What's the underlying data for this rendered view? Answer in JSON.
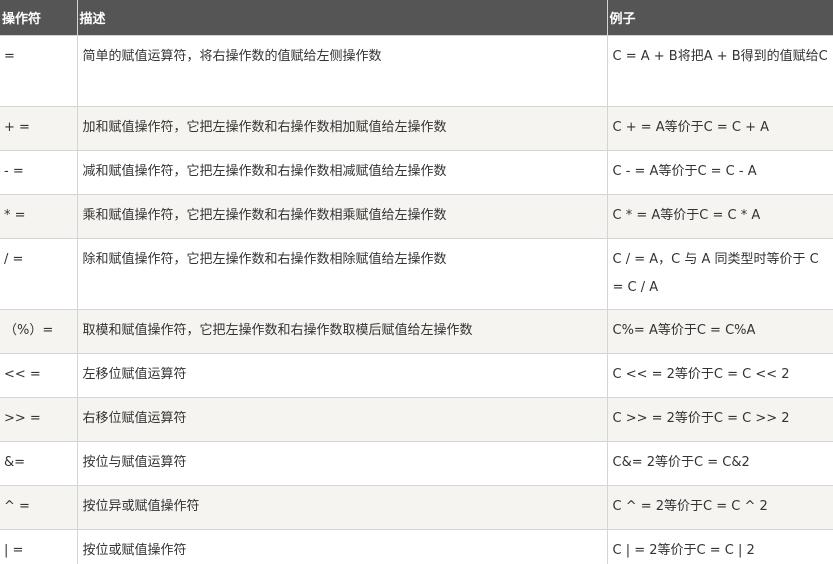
{
  "table": {
    "headers": [
      "操作符",
      "描述",
      "例子"
    ],
    "rows": [
      {
        "op": "=",
        "desc": "简单的赋值运算符，将右操作数的值赋给左侧操作数",
        "example": "C = A + B将把A + B得到的值赋给C"
      },
      {
        "op": "+ =",
        "desc": "加和赋值操作符，它把左操作数和右操作数相加赋值给左操作数",
        "example": "C + = A等价于C = C + A"
      },
      {
        "op": "- =",
        "desc": "减和赋值操作符，它把左操作数和右操作数相减赋值给左操作数",
        "example": "C - = A等价于C = C - A"
      },
      {
        "op": "* =",
        "desc": "乘和赋值操作符，它把左操作数和右操作数相乘赋值给左操作数",
        "example": "C * = A等价于C = C * A"
      },
      {
        "op": "/ =",
        "desc": "除和赋值操作符，它把左操作数和右操作数相除赋值给左操作数",
        "example": "C / = A，C 与 A 同类型时等价于 C = C / A"
      },
      {
        "op": "（%）=",
        "desc": "取模和赋值操作符，它把左操作数和右操作数取模后赋值给左操作数",
        "example": "C%= A等价于C = C%A"
      },
      {
        "op": "<< =",
        "desc": "左移位赋值运算符",
        "example": "C << = 2等价于C = C << 2"
      },
      {
        "op": ">> =",
        "desc": "右移位赋值运算符",
        "example": "C >> = 2等价于C = C >> 2"
      },
      {
        "op": "&=",
        "desc": "按位与赋值运算符",
        "example": "C&= 2等价于C = C&2"
      },
      {
        "op": "^ =",
        "desc": "按位异或赋值操作符",
        "example": "C ^ = 2等价于C = C ^ 2"
      },
      {
        "op": "| =",
        "desc": "按位或赋值操作符",
        "example": "C | = 2等价于C = C | 2"
      }
    ]
  },
  "colors": {
    "header_bg": "#555555",
    "header_text": "#ffffff",
    "stripe": "#f6f4f0",
    "border": "#d4d4d4"
  }
}
